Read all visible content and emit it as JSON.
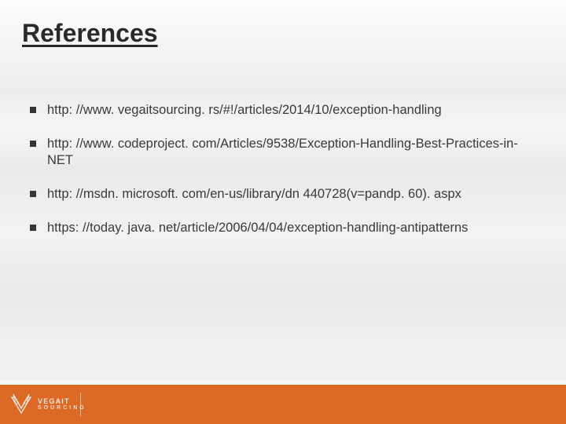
{
  "title": "References",
  "bullets": [
    "http: //www. vegaitsourcing. rs/#!/articles/2014/10/exception-handling",
    "http: //www. codeproject. com/Articles/9538/Exception-Handling-Best-Practices-in-NET",
    "http: //msdn. microsoft. com/en-us/library/dn 440728(v=pandp. 60). aspx",
    "https: //today. java. net/article/2006/04/04/exception-handling-antipatterns"
  ],
  "brand": {
    "name": "VEGAIT",
    "sub": "SOURCING"
  }
}
